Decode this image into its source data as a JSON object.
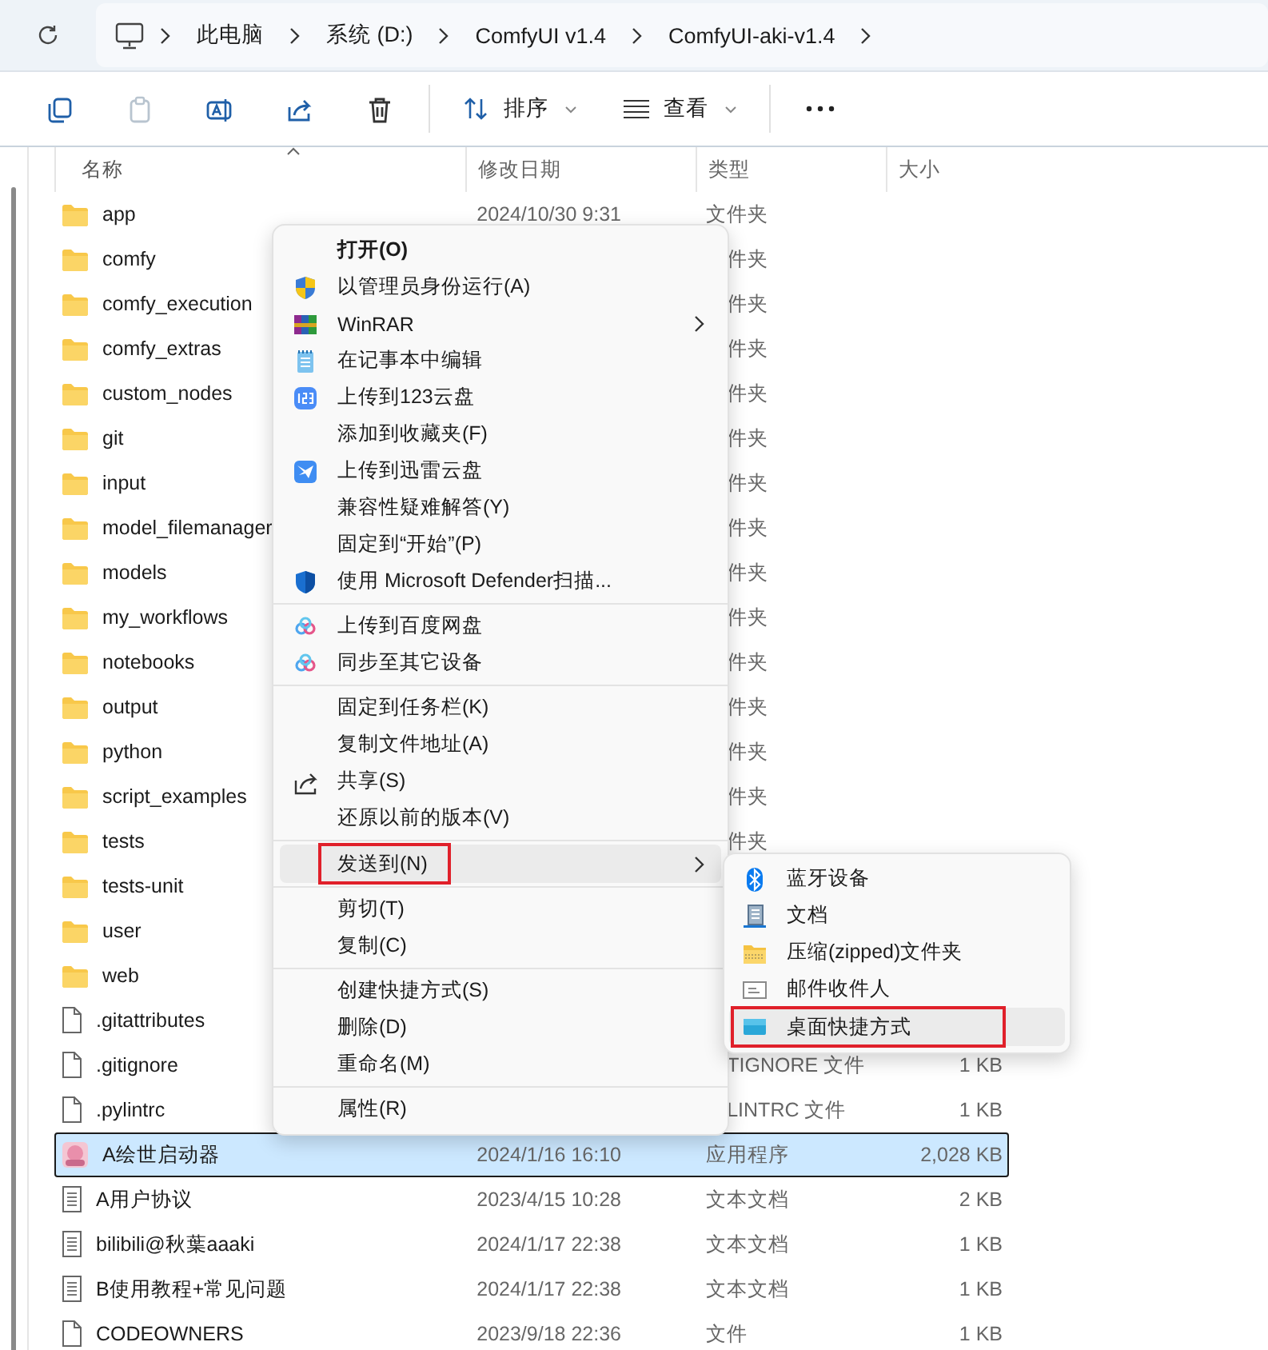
{
  "breadcrumb": [
    "此电脑",
    "系统 (D:)",
    "ComfyUI v1.4",
    "ComfyUI-aki-v1.4"
  ],
  "toolbar": {
    "buttons": [
      {
        "disabled": false
      },
      {
        "disabled": true
      },
      {
        "disabled": false
      },
      {
        "disabled": false
      },
      {
        "disabled": false
      }
    ],
    "sort": "排序",
    "view": "查看"
  },
  "columns": [
    "名称",
    "修改日期",
    "类型",
    "大小"
  ],
  "rows": [
    {
      "kind": "folder",
      "name": "app",
      "date": "2024/10/30 9:31",
      "type": "文件夹",
      "selected": false
    },
    {
      "kind": "folder",
      "name": "comfy",
      "type": "件夹",
      "selected": false
    },
    {
      "kind": "folder",
      "name": "comfy_execution",
      "type": "件夹",
      "selected": false
    },
    {
      "kind": "folder",
      "name": "comfy_extras",
      "type": "件夹",
      "selected": false
    },
    {
      "kind": "folder",
      "name": "custom_nodes",
      "type": "件夹",
      "selected": false
    },
    {
      "kind": "folder",
      "name": "git",
      "type": "件夹",
      "selected": false
    },
    {
      "kind": "folder",
      "name": "input",
      "type": "件夹",
      "selected": false
    },
    {
      "kind": "folder",
      "name": "model_filemanager",
      "type": "件夹",
      "selected": false
    },
    {
      "kind": "folder",
      "name": "models",
      "type": "件夹",
      "selected": false
    },
    {
      "kind": "folder",
      "name": "my_workflows",
      "type": "件夹",
      "selected": false
    },
    {
      "kind": "folder",
      "name": "notebooks",
      "type": "件夹",
      "selected": false
    },
    {
      "kind": "folder",
      "name": "output",
      "type": "件夹",
      "selected": false
    },
    {
      "kind": "folder",
      "name": "python",
      "type": "件夹",
      "selected": false
    },
    {
      "kind": "folder",
      "name": "script_examples",
      "type": "件夹",
      "selected": false
    },
    {
      "kind": "folder",
      "name": "tests",
      "type": "件夹",
      "selected": false
    },
    {
      "kind": "folder",
      "name": "tests-unit",
      "selected": false
    },
    {
      "kind": "folder",
      "name": "user",
      "selected": false
    },
    {
      "kind": "folder",
      "name": "web",
      "selected": false
    },
    {
      "kind": "file",
      "name": ".gitattributes",
      "selected": false
    },
    {
      "kind": "file",
      "name": ".gitignore",
      "type": "TIGNORE 文件",
      "size": "1 KB",
      "selected": false
    },
    {
      "kind": "file",
      "name": ".pylintrc",
      "type": "LINTRC 文件",
      "size": "1 KB",
      "selected": false
    },
    {
      "kind": "app",
      "name": "A绘世启动器",
      "date": "2024/1/16 16:10",
      "type": "应用程序",
      "size": "2,028 KB",
      "selected": true
    },
    {
      "kind": "text",
      "name": "A用户协议",
      "date": "2023/4/15 10:28",
      "type": "文本文档",
      "size": "2 KB",
      "selected": false
    },
    {
      "kind": "text",
      "name": "bilibili@秋葉aaaki",
      "date": "2024/1/17 22:38",
      "type": "文本文档",
      "size": "1 KB",
      "selected": false
    },
    {
      "kind": "text",
      "name": "B使用教程+常见问题",
      "date": "2024/1/17 22:38",
      "type": "文本文档",
      "size": "1 KB",
      "selected": false
    },
    {
      "kind": "file",
      "name": "CODEOWNERS",
      "date": "2023/9/18 22:36",
      "type": "文件",
      "size": "1 KB",
      "selected": false
    }
  ],
  "context_menu": {
    "groups": [
      [
        {
          "label": "打开(O)",
          "bold": true
        },
        {
          "label": "以管理员身份运行(A)",
          "kind": "uac-shield"
        },
        {
          "label": "WinRAR",
          "kind": "archive",
          "submenu": true
        },
        {
          "label": "在记事本中编辑",
          "kind": "notepad"
        },
        {
          "label": "上传到123云盘",
          "kind": "cloud-123"
        },
        {
          "label": "添加到收藏夹(F)"
        },
        {
          "label": "上传到迅雷云盘",
          "kind": "bird"
        },
        {
          "label": "兼容性疑难解答(Y)"
        },
        {
          "label": "固定到“开始”(P)"
        },
        {
          "label": "使用 Microsoft Defender扫描...",
          "kind": "shield"
        }
      ],
      [
        {
          "label": "上传到百度网盘",
          "kind": "cloud"
        },
        {
          "label": "同步至其它设备",
          "kind": "cloud"
        }
      ],
      [
        {
          "label": "固定到任务栏(K)"
        },
        {
          "label": "复制文件地址(A)"
        },
        {
          "label": "共享(S)",
          "kind": "share"
        },
        {
          "label": "还原以前的版本(V)"
        }
      ],
      [
        {
          "label": "发送到(N)",
          "submenu": true,
          "hovered": true,
          "annotated": true
        }
      ],
      [
        {
          "label": "剪切(T)"
        },
        {
          "label": "复制(C)"
        }
      ],
      [
        {
          "label": "创建快捷方式(S)"
        },
        {
          "label": "删除(D)"
        },
        {
          "label": "重命名(M)"
        }
      ],
      [
        {
          "label": "属性(R)"
        }
      ]
    ]
  },
  "send_to_menu": [
    {
      "label": "蓝牙设备",
      "kind": "bluetooth",
      "hovered": false,
      "annotated": false
    },
    {
      "label": "文档",
      "kind": "document",
      "hovered": false,
      "annotated": false
    },
    {
      "label": "压缩(zipped)文件夹",
      "kind": "zip",
      "hovered": false,
      "annotated": false
    },
    {
      "label": "邮件收件人",
      "kind": "mail",
      "hovered": false,
      "annotated": false
    },
    {
      "label": "桌面快捷方式",
      "kind": "desktop",
      "hovered": true,
      "annotated": true
    }
  ]
}
